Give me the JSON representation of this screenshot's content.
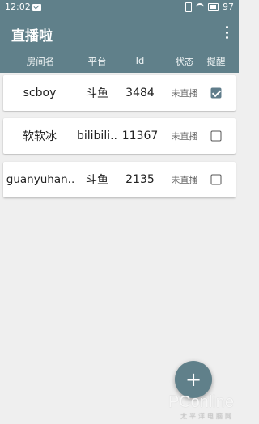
{
  "status_bar": {
    "time": "12:02",
    "battery": "97",
    "icons": [
      "mail-icon",
      "vibrate-icon",
      "wifi-icon",
      "battery-icon"
    ]
  },
  "app_bar": {
    "title": "直播啦",
    "menu_icon": "more-vert-icon"
  },
  "columns": {
    "room": "房间名",
    "platform": "平台",
    "id": "Id",
    "state": "状态",
    "remind": "提醒"
  },
  "rooms": [
    {
      "name": "scboy",
      "platform": "斗鱼",
      "id": "3484",
      "state": "未直播",
      "remind": true
    },
    {
      "name": "软软冰",
      "platform": "bilibili..",
      "id": "11367",
      "state": "未直播",
      "remind": false
    },
    {
      "name": "guanyuhan..",
      "platform": "斗鱼",
      "id": "2135",
      "state": "未直播",
      "remind": false
    }
  ],
  "fab": {
    "label": "+",
    "icon": "add-icon"
  },
  "watermark": {
    "brand": "PConline",
    "sub": "太平洋电脑网"
  },
  "colors": {
    "primary": "#60808a",
    "background": "#efefef",
    "checked": "#607d8b"
  }
}
